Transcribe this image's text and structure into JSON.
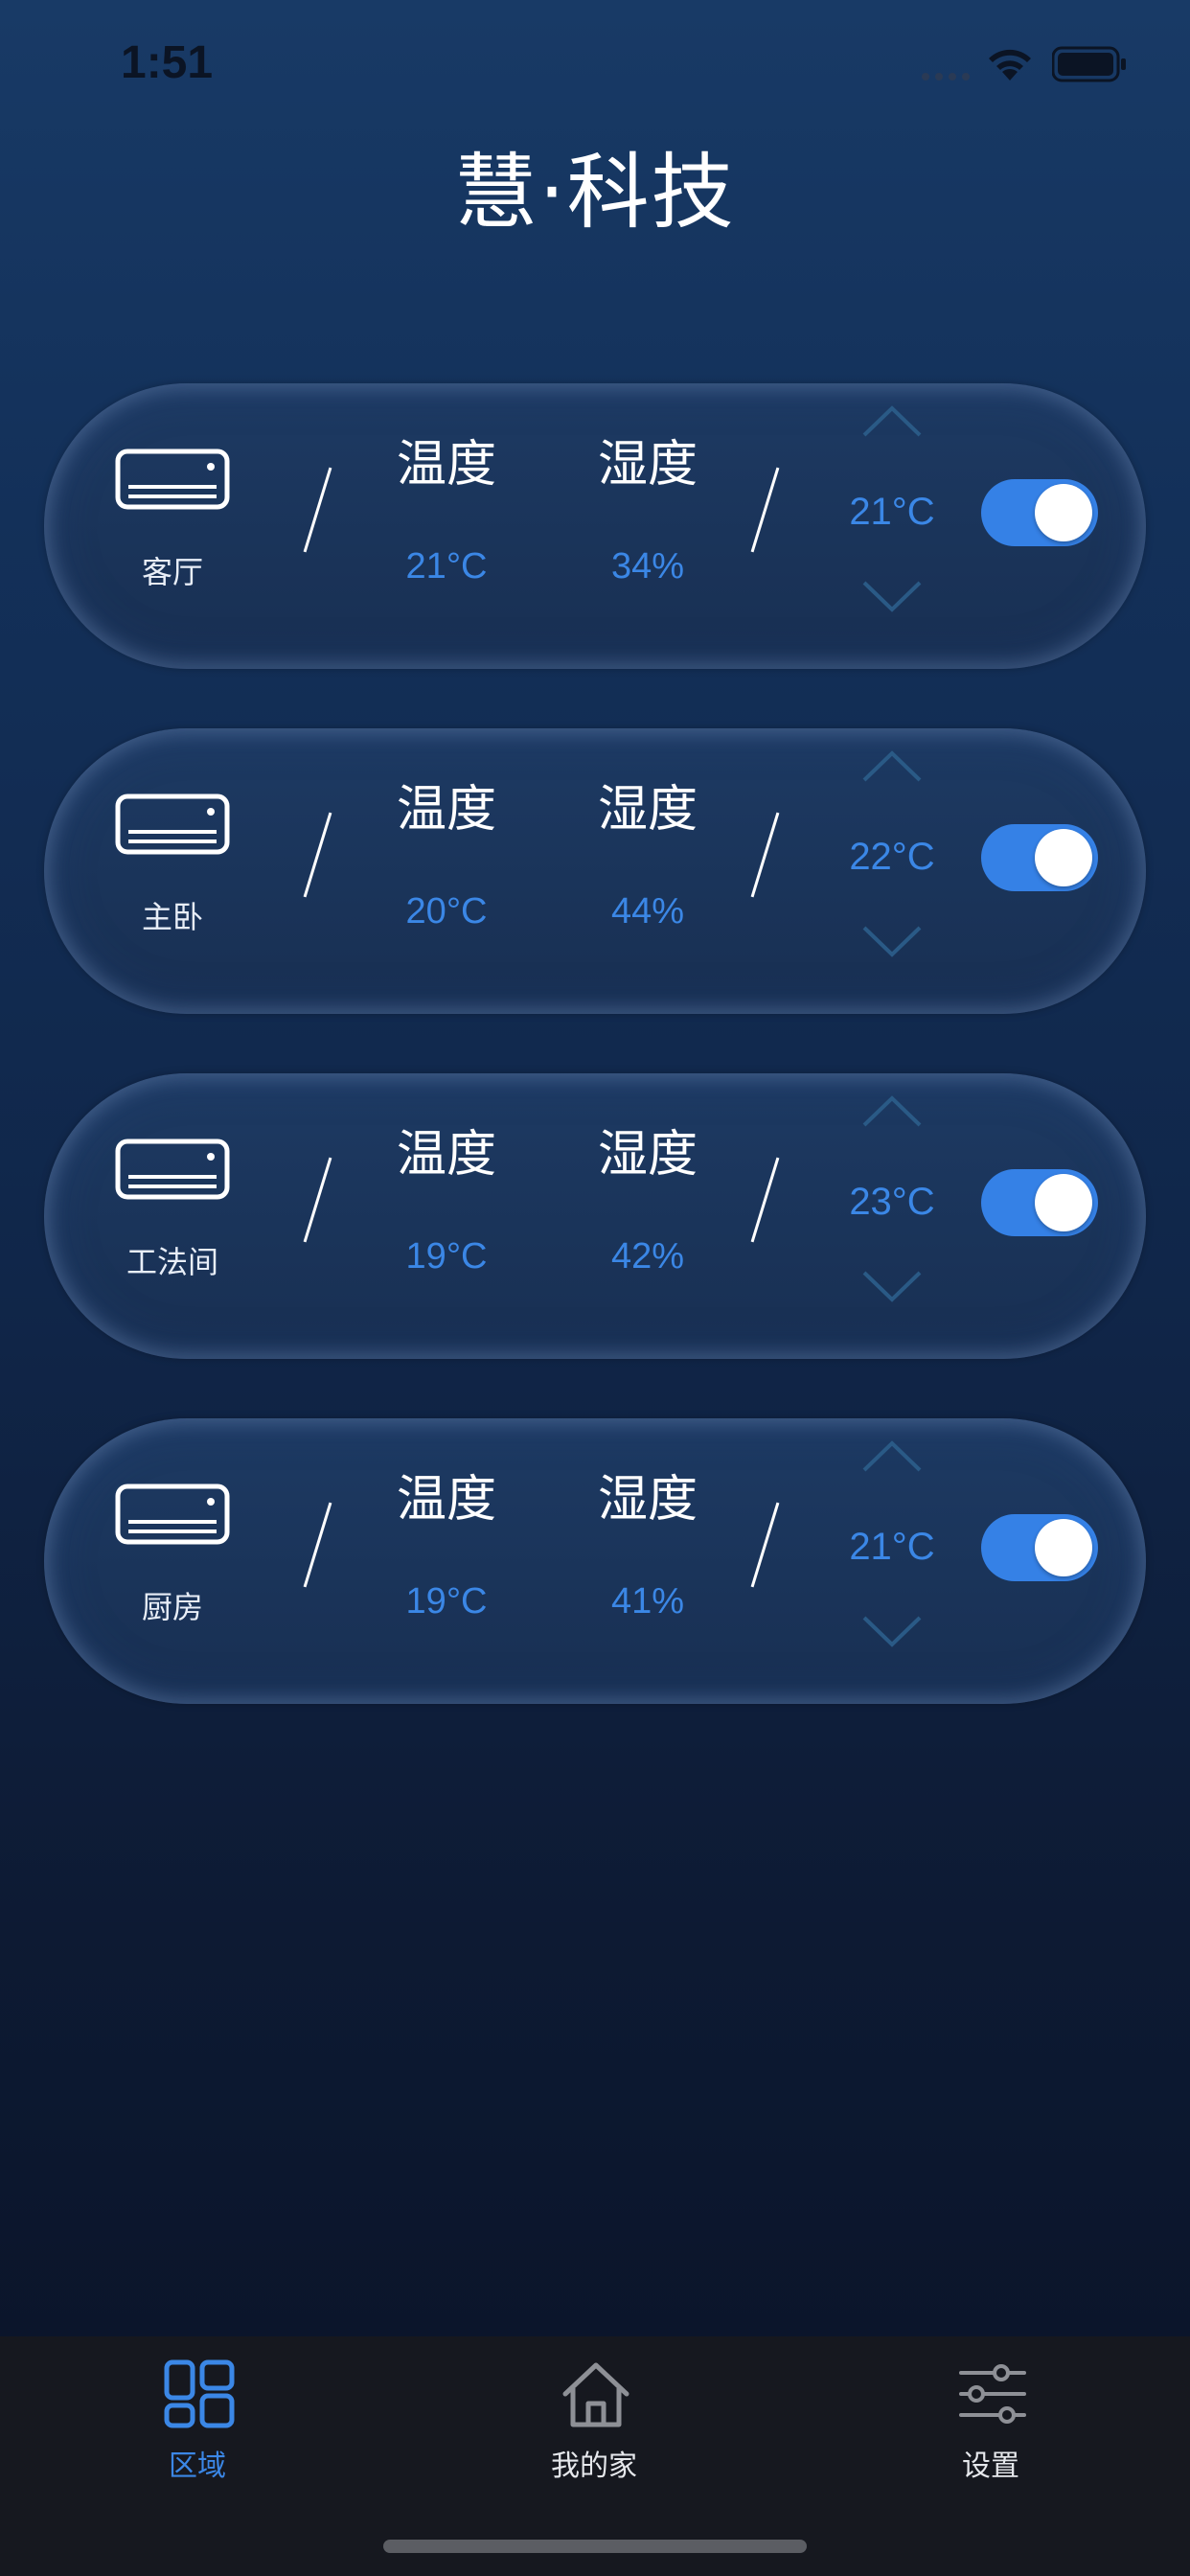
{
  "status_bar": {
    "time": "1:51"
  },
  "app": {
    "title": "慧·科技"
  },
  "colors": {
    "accent": "#3b87e6",
    "toggle_on": "#3581e6",
    "inactive_tab": "#8e9096"
  },
  "rooms": [
    {
      "name": "客厅",
      "temp_label": "温度",
      "humidity_label": "湿度",
      "temperature": "21°C",
      "humidity": "34%",
      "setpoint": "21°C",
      "power_on": true
    },
    {
      "name": "主卧",
      "temp_label": "温度",
      "humidity_label": "湿度",
      "temperature": "20°C",
      "humidity": "44%",
      "setpoint": "22°C",
      "power_on": true
    },
    {
      "name": "工法间",
      "temp_label": "温度",
      "humidity_label": "湿度",
      "temperature": "19°C",
      "humidity": "42%",
      "setpoint": "23°C",
      "power_on": true
    },
    {
      "name": "厨房",
      "temp_label": "温度",
      "humidity_label": "湿度",
      "temperature": "19°C",
      "humidity": "41%",
      "setpoint": "21°C",
      "power_on": true
    }
  ],
  "tabs": [
    {
      "label": "区域",
      "icon": "grid-icon",
      "active": true
    },
    {
      "label": "我的家",
      "icon": "home-icon",
      "active": false
    },
    {
      "label": "设置",
      "icon": "sliders-icon",
      "active": false
    }
  ]
}
